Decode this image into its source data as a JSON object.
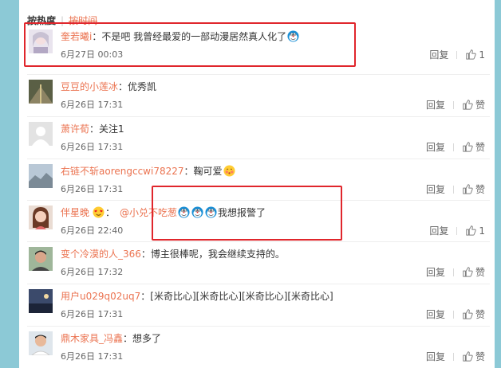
{
  "sort": {
    "by_heat": "按热度",
    "by_time": "按时间"
  },
  "comments": [
    {
      "user": "奎若曦i",
      "parts": [
        {
          "t": "text",
          "v": "不是吧 我曾经最爱的一部动漫居然真人化了"
        },
        {
          "t": "emo",
          "v": "doraemon-face"
        }
      ],
      "time": "6月27日 00:03",
      "reply": "回复",
      "like": "1"
    },
    {
      "user": "豆豆的小莲冰",
      "parts": [
        {
          "t": "text",
          "v": "优秀凯"
        }
      ],
      "time": "6月26日 17:31",
      "reply": "回复",
      "like": "赞"
    },
    {
      "user": "萧许荀",
      "parts": [
        {
          "t": "text",
          "v": "关注1"
        }
      ],
      "time": "6月26日 17:31",
      "reply": "回复",
      "like": "赞"
    },
    {
      "user": "右链不斩aorengccwi78227",
      "parts": [
        {
          "t": "text",
          "v": "鞠可爱"
        },
        {
          "t": "emo",
          "v": "blush-face"
        }
      ],
      "time": "6月26日 17:31",
      "reply": "回复",
      "like": "赞"
    },
    {
      "user": "伴星晚",
      "badge": "heart-face",
      "parts": [
        {
          "t": "mention",
          "v": "@小兑不吃葱"
        },
        {
          "t": "emo",
          "v": "doraemon-face"
        },
        {
          "t": "emo",
          "v": "doraemon-face"
        },
        {
          "t": "emo",
          "v": "doraemon-face"
        },
        {
          "t": "text",
          "v": "我想报警了"
        }
      ],
      "time": "6月26日 22:40",
      "reply": "回复",
      "like": "1"
    },
    {
      "user": "变个冷漠的人_366",
      "parts": [
        {
          "t": "text",
          "v": "博主很棒呢，我会继续支持的。"
        }
      ],
      "time": "6月26日 17:32",
      "reply": "回复",
      "like": "赞"
    },
    {
      "user": "用户u029q02uq7",
      "parts": [
        {
          "t": "text",
          "v": "[米奇比心][米奇比心][米奇比心][米奇比心]"
        }
      ],
      "time": "6月26日 17:31",
      "reply": "回复",
      "like": "赞"
    },
    {
      "user": "鼎木家具_冯鑫",
      "parts": [
        {
          "t": "text",
          "v": "想多了"
        }
      ],
      "time": "6月26日 17:31",
      "reply": "回复",
      "like": "赞"
    }
  ],
  "colors": {
    "username": "#eb7350",
    "highlight_box": "#e0262c",
    "background": "#8cc9d6"
  }
}
